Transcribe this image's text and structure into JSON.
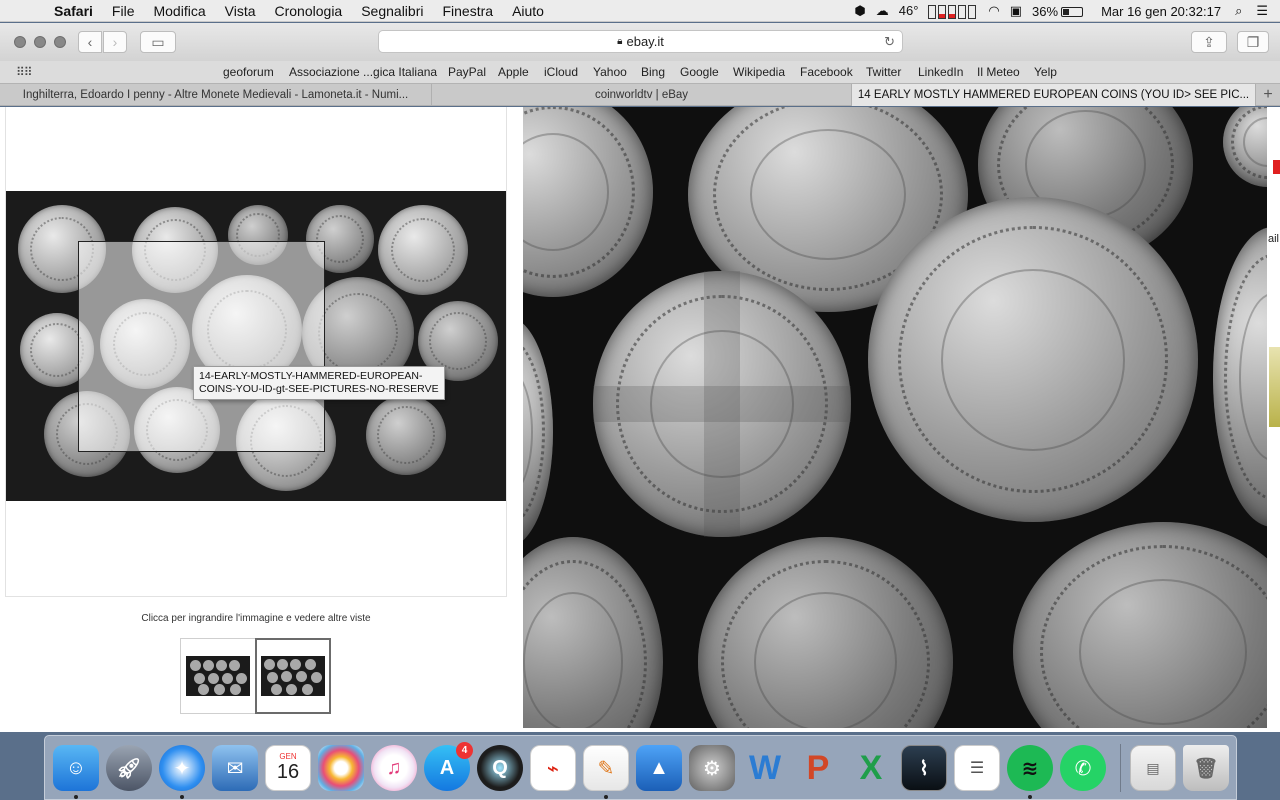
{
  "menubar": {
    "apple_icon": "apple-logo",
    "app_name": "Safari",
    "items": [
      "File",
      "Modifica",
      "Vista",
      "Cronologia",
      "Segnalibri",
      "Finestra",
      "Aiuto"
    ],
    "temperature": "46°",
    "battery": "36%",
    "datetime": "Mar 16 gen  20:32:17"
  },
  "toolbar": {
    "address": "ebay.it"
  },
  "bookmarks": [
    "geoforum",
    "Associazione ...gica Italiana",
    "PayPal",
    "Apple",
    "iCloud",
    "Yahoo",
    "Bing",
    "Google",
    "Wikipedia",
    "Facebook",
    "Twitter",
    "LinkedIn",
    "Il Meteo",
    "Yelp"
  ],
  "tabs": [
    {
      "label": "Inghilterra, Edoardo I penny - Altre Monete Medievali - Lamoneta.it - Numi..."
    },
    {
      "label": "coinworldtv | eBay"
    },
    {
      "label": "14 EARLY MOSTLY HAMMERED EUROPEAN COINS (YOU ID> SEE PIC..."
    }
  ],
  "listing": {
    "tooltip": "14-EARLY-MOSTLY-HAMMERED-EUROPEAN-COINS-YOU-ID-gt-SEE-PICTURES-NO-RESERVE",
    "caption": "Clicca per ingrandire l'immagine e vedere altre viste",
    "side_text": "ail"
  },
  "dock": {
    "calendar_month": "GEN",
    "calendar_day": "16",
    "appstore_badge": "4",
    "word_letter": "W",
    "ppt_letter": "P",
    "excel_letter": "X"
  }
}
